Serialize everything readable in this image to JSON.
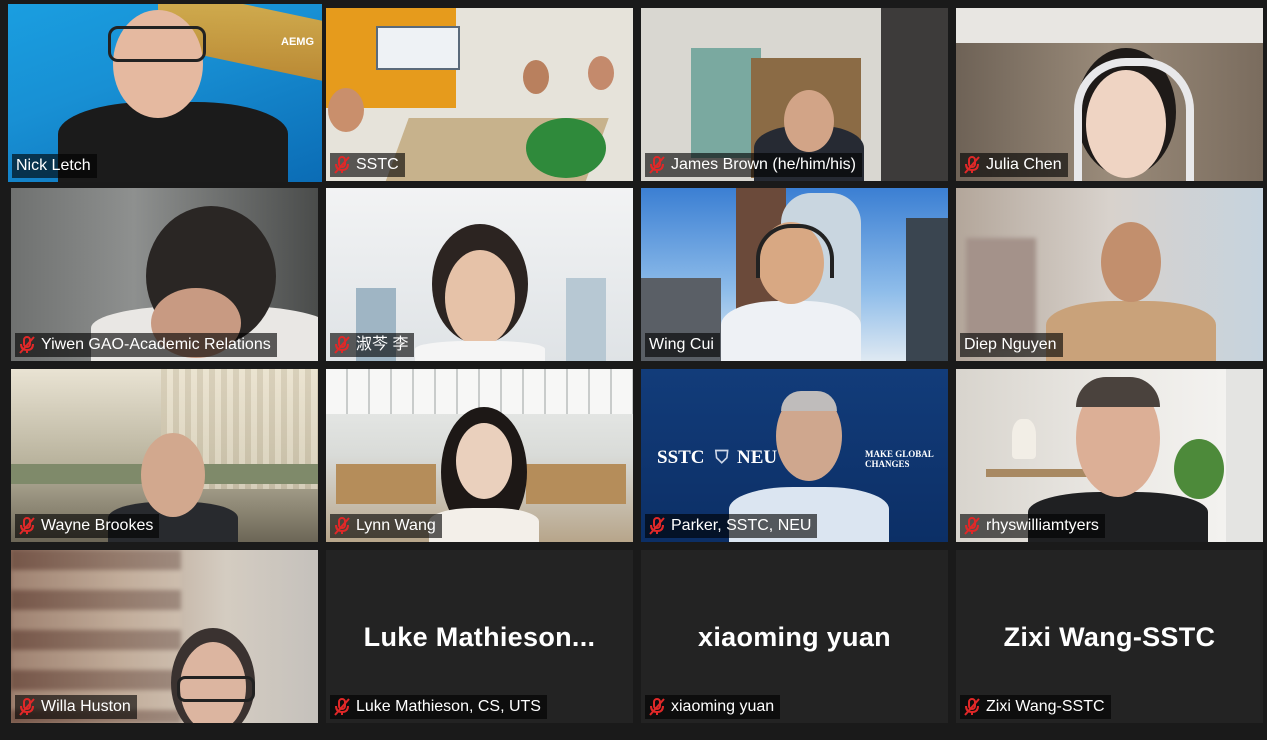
{
  "participants": [
    {
      "display_name": "Nick Letch",
      "muted": false,
      "active_speaker": true,
      "logo": "AEMG"
    },
    {
      "display_name": "SSTC",
      "muted": true
    },
    {
      "display_name": "James Brown (he/him/his)",
      "muted": true
    },
    {
      "display_name": "Julia Chen",
      "muted": true
    },
    {
      "display_name": "Yiwen GAO-Academic Relations",
      "muted": true
    },
    {
      "display_name": "淑芩 李",
      "muted": true
    },
    {
      "display_name": "Wing Cui",
      "muted": false
    },
    {
      "display_name": "Diep Nguyen",
      "muted": false
    },
    {
      "display_name": "Wayne Brookes",
      "muted": true
    },
    {
      "display_name": "Lynn Wang",
      "muted": true
    },
    {
      "display_name": "Parker, SSTC, NEU",
      "muted": true,
      "background_text": [
        "SSTC",
        "NEU",
        "MAKE GLOBAL",
        "CHANGES"
      ]
    },
    {
      "display_name": "rhyswilliamtyers",
      "muted": true
    },
    {
      "display_name": "Willa Huston",
      "muted": true
    },
    {
      "display_name": "Luke Mathieson, CS, UTS",
      "muted": true,
      "video_off": true,
      "big_label": "Luke  Mathieson..."
    },
    {
      "display_name": "xiaoming yuan",
      "muted": true,
      "video_off": true,
      "big_label": "xiaoming yuan"
    },
    {
      "display_name": "Zixi Wang-SSTC",
      "muted": true,
      "video_off": true,
      "big_label": "Zixi Wang-SSTC"
    }
  ],
  "colors": {
    "active_border": "#e8f06a",
    "muted_icon": "#e02828",
    "background": "#1a1a1a"
  },
  "icons": {
    "muted": "mic-muted-icon"
  }
}
